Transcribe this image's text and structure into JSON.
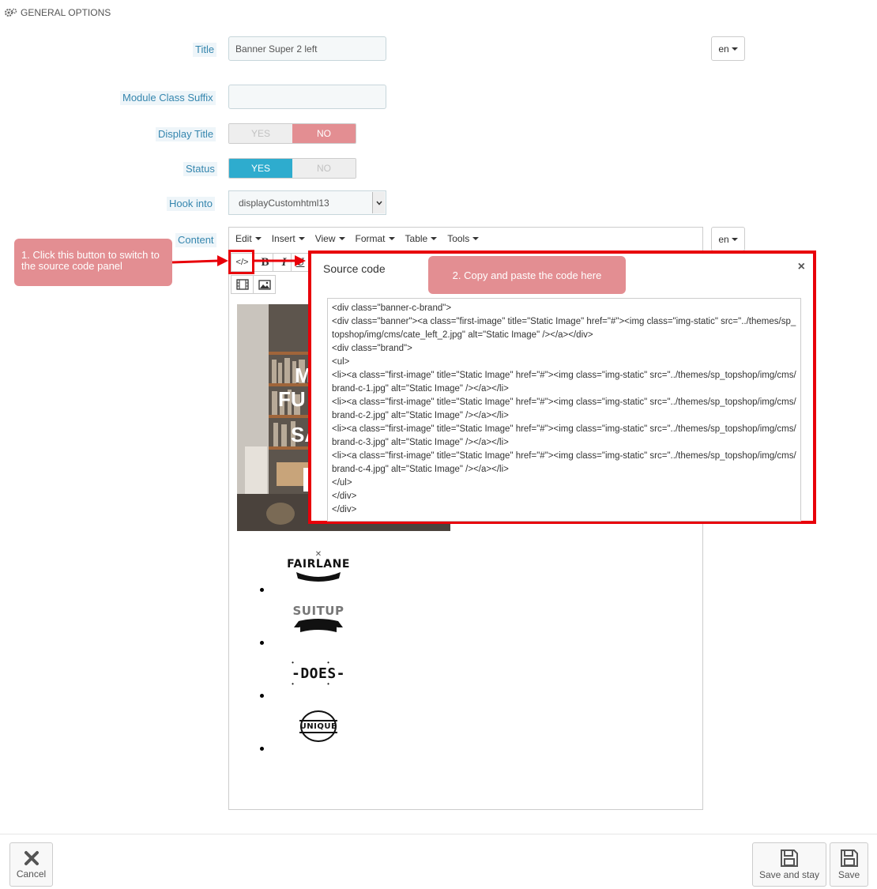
{
  "panel": {
    "heading": "GENERAL OPTIONS",
    "icon": "cogs-icon"
  },
  "form": {
    "title": {
      "label": "Title",
      "value": "Banner Super 2 left",
      "lang": "en"
    },
    "module_class_suffix": {
      "label": "Module Class Suffix",
      "value": ""
    },
    "display_title": {
      "label": "Display Title",
      "yes": "YES",
      "no": "NO",
      "selected": "NO"
    },
    "status": {
      "label": "Status",
      "yes": "YES",
      "no": "NO",
      "selected": "YES"
    },
    "hook_into": {
      "label": "Hook into",
      "value": "displayCustomhtml13"
    },
    "content": {
      "label": "Content",
      "lang": "en"
    }
  },
  "editor": {
    "menu": [
      "Edit",
      "Insert",
      "View",
      "Format",
      "Table",
      "Tools"
    ],
    "toolbar": {
      "source_code": "</>",
      "bold": "B",
      "italic": "I",
      "underline": "U"
    },
    "banner_text": [
      "M",
      "FU",
      "SA"
    ],
    "brands": [
      "FAIRLANE",
      "SUITUP",
      "-DOES-",
      "UNIQUE"
    ]
  },
  "annotations": {
    "step1": "1. Click this button to switch to the source code panel",
    "step2": "2. Copy and paste the code here"
  },
  "dialog": {
    "title": "Source code",
    "close": "×",
    "code": "<div class=\"banner-c-brand\">\n<div class=\"banner\"><a class=\"first-image\" title=\"Static Image\" href=\"#\"><img class=\"img-static\" src=\"../themes/sp_topshop/img/cms/cate_left_2.jpg\" alt=\"Static Image\" /></a></div>\n<div class=\"brand\">\n<ul>\n<li><a class=\"first-image\" title=\"Static Image\" href=\"#\"><img class=\"img-static\" src=\"../themes/sp_topshop/img/cms/brand-c-1.jpg\" alt=\"Static Image\" /></a></li>\n<li><a class=\"first-image\" title=\"Static Image\" href=\"#\"><img class=\"img-static\" src=\"../themes/sp_topshop/img/cms/brand-c-2.jpg\" alt=\"Static Image\" /></a></li>\n<li><a class=\"first-image\" title=\"Static Image\" href=\"#\"><img class=\"img-static\" src=\"../themes/sp_topshop/img/cms/brand-c-3.jpg\" alt=\"Static Image\" /></a></li>\n<li><a class=\"first-image\" title=\"Static Image\" href=\"#\"><img class=\"img-static\" src=\"../themes/sp_topshop/img/cms/brand-c-4.jpg\" alt=\"Static Image\" /></a></li>\n</ul>\n</div>\n</div>"
  },
  "footer": {
    "cancel": "Cancel",
    "save_and_stay": "Save and stay",
    "save": "Save"
  },
  "colors": {
    "accent": "#2eacce",
    "no_active": "#e38e92",
    "callout": "#e38e92",
    "highlight_red": "#e8000a",
    "label_blue": "#3586ae"
  }
}
